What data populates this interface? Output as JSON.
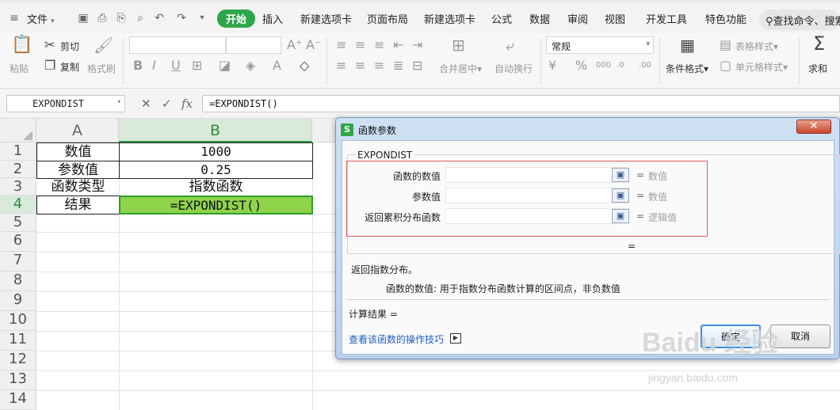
{
  "menu": {
    "file_label": "文件",
    "tabs": [
      {
        "label": "开始",
        "active": true
      },
      {
        "label": "插入"
      },
      {
        "label": "新建选项卡"
      },
      {
        "label": "页面布局"
      },
      {
        "label": "新建选项卡"
      },
      {
        "label": "公式"
      },
      {
        "label": "数据"
      },
      {
        "label": "审阅"
      },
      {
        "label": "视图"
      },
      {
        "label": "开发工具"
      },
      {
        "label": "特色功能"
      }
    ],
    "search_label": "查找命令、搜索",
    "accent_color": "#2fa54a"
  },
  "ribbon": {
    "paste_label": "粘贴",
    "cut_label": "剪切",
    "copy_label": "复制",
    "format_painter_label": "格式刷",
    "merge_label": "合并居中",
    "wrap_label": "自动换行",
    "number_format_value": "常规",
    "percent_symbol": "%",
    "conditional_format_label": "条件格式",
    "table_style_label": "表格样式",
    "cell_style_label": "单元格样式",
    "sum_label": "求和"
  },
  "formula_bar": {
    "name_box_value": "EXPONDIST",
    "fx_label": "fx",
    "formula_value": "=EXPONDIST()"
  },
  "sheet": {
    "columns": [
      "A",
      "B"
    ],
    "rows": [
      "1",
      "2",
      "3",
      "4",
      "5",
      "6",
      "7",
      "8",
      "9",
      "10",
      "11",
      "12",
      "13",
      "14"
    ],
    "cells": {
      "a1": "数值",
      "b1": "1000",
      "a2": "参数值",
      "b2": "0.25",
      "a3": "函数类型",
      "b3": "指数函数",
      "a4": "结果",
      "b4": "=EXPONDIST()"
    },
    "active_cell_color": "#8fd34a"
  },
  "dialog": {
    "title": "函数参数",
    "function_name": "EXPONDIST",
    "args": [
      {
        "label": "函数的数值",
        "eq": "=",
        "type": "数值"
      },
      {
        "label": "参数值",
        "eq": "=",
        "type": "数值"
      },
      {
        "label": "返回累积分布函数",
        "eq": "=",
        "type": "逻辑值"
      }
    ],
    "result_eq": "=",
    "description": "返回指数分布。",
    "arg_description": "函数的数值:  用于指数分布函数计算的区间点，非负数值",
    "calc_result_label": "计算结果  =",
    "help_link": "查看该函数的操作技巧",
    "ok_label": "确定",
    "cancel_label": "取消"
  },
  "watermark": {
    "line1": "Baidu 经验",
    "line2": "jingyan.baidu.com"
  }
}
